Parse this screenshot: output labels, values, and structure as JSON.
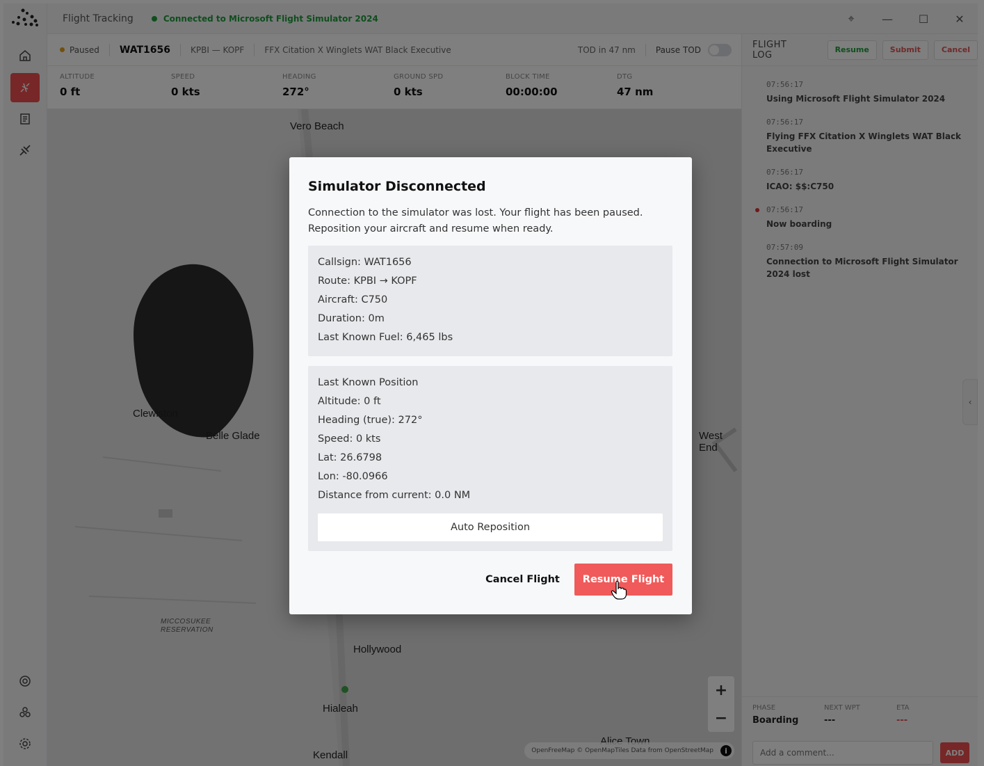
{
  "titlebar": {
    "title": "Flight Tracking",
    "connection_status": "Connected to Microsoft Flight Simulator 2024"
  },
  "status_bar": {
    "state": "Paused",
    "callsign": "WAT1656",
    "route": "KPBI — KOPF",
    "aircraft": "FFX Citation X Winglets WAT Black Executive",
    "tod": "TOD in 47 nm",
    "pause_tod_label": "Pause TOD",
    "pause_tod_enabled": false
  },
  "metrics": [
    {
      "label": "ALTITUDE",
      "value": "0 ft"
    },
    {
      "label": "SPEED",
      "value": "0 kts"
    },
    {
      "label": "HEADING",
      "value": "272°"
    },
    {
      "label": "GROUND SPD",
      "value": "0 kts"
    },
    {
      "label": "BLOCK TIME",
      "value": "00:00:00"
    },
    {
      "label": "DTG",
      "value": "47 nm"
    }
  ],
  "map": {
    "places": [
      "Vero Beach",
      "Clewiston",
      "Belle Glade",
      "West End",
      "Hollywood",
      "Hialeah",
      "Kendall",
      "Alice Town",
      "MICCOSUKEE",
      "RESERVATION"
    ],
    "attribution": "OpenFreeMap © OpenMapTiles Data from OpenStreetMap",
    "zoom_in": "+",
    "zoom_out": "−"
  },
  "flight_log": {
    "title": "FLIGHT LOG",
    "resume_label": "Resume",
    "submit_label": "Submit",
    "cancel_label": "Cancel",
    "entries": [
      {
        "time": "07:56:17",
        "message": "Using Microsoft Flight Simulator 2024",
        "highlight": false
      },
      {
        "time": "07:56:17",
        "message": "Flying FFX Citation X Winglets WAT Black Executive",
        "highlight": false
      },
      {
        "time": "07:56:17",
        "message": "ICAO: $$:C750",
        "highlight": false
      },
      {
        "time": "07:56:17",
        "message": "Now boarding",
        "highlight": true
      },
      {
        "time": "07:57:09",
        "message": "Connection to Microsoft Flight Simulator 2024 lost",
        "highlight": false
      }
    ],
    "footer": {
      "phase_label": "PHASE",
      "phase_value": "Boarding",
      "next_wpt_label": "NEXT WPT",
      "next_wpt_value": "---",
      "eta_label": "ETA",
      "eta_value": "---"
    },
    "comment_placeholder": "Add a comment...",
    "add_label": "ADD"
  },
  "modal": {
    "title": "Simulator Disconnected",
    "description_line1": "Connection to the simulator was lost. Your flight has been paused.",
    "description_line2": "Reposition your aircraft and resume when ready.",
    "flight_info": [
      "Callsign: WAT1656",
      "Route: KPBI → KOPF",
      "Aircraft: C750",
      "Duration: 0m",
      "Last Known Fuel: 6,465 lbs"
    ],
    "position_info": [
      "Last Known Position",
      "Altitude: 0 ft",
      "Heading (true): 272°",
      "Speed: 0 kts",
      "Lat: 26.6798",
      "Lon: -80.0966",
      "Distance from current: 0.0 NM"
    ],
    "auto_reposition_label": "Auto Reposition",
    "cancel_label": "Cancel Flight",
    "resume_label": "Resume Flight"
  },
  "colors": {
    "accent": "#f05a5a",
    "connected": "#1f9d3a",
    "paused": "#e3a019"
  }
}
